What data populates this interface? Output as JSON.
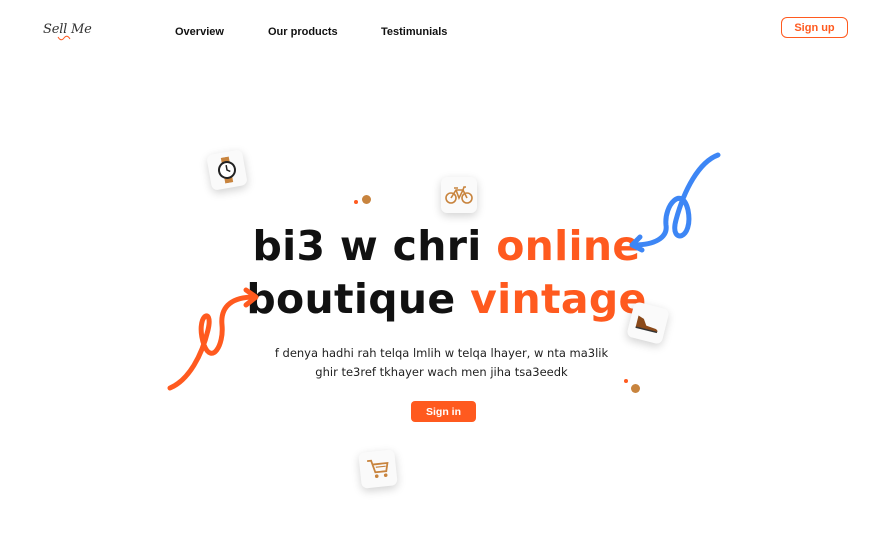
{
  "brand": {
    "logo_text": "Sell Me"
  },
  "nav": {
    "items": [
      {
        "label": "Overview"
      },
      {
        "label": "Our products"
      },
      {
        "label": "Testimunials"
      }
    ],
    "signup_label": "Sign up"
  },
  "hero": {
    "title_line1_main": "bi3 w chri",
    "title_line1_accent": "online",
    "title_line2_main": "boutique",
    "title_line2_accent": "vintage",
    "subtitle_line1": "f denya hadhi rah telqa lmlih w telqa lhayer, w nta ma3lik",
    "subtitle_line2": "ghir te3ref tkhayer wach men jiha tsa3eedk",
    "signin_label": "Sign in"
  },
  "icons": [
    "watch-icon",
    "bicycle-icon",
    "shoe-icon",
    "shopping-cart-icon",
    "blue-loop-arrow-icon",
    "orange-loop-arrow-icon"
  ],
  "colors": {
    "accent": "#ff5a1f",
    "blue_arrow": "#3d86f5",
    "dot_brown": "#c8843e"
  }
}
